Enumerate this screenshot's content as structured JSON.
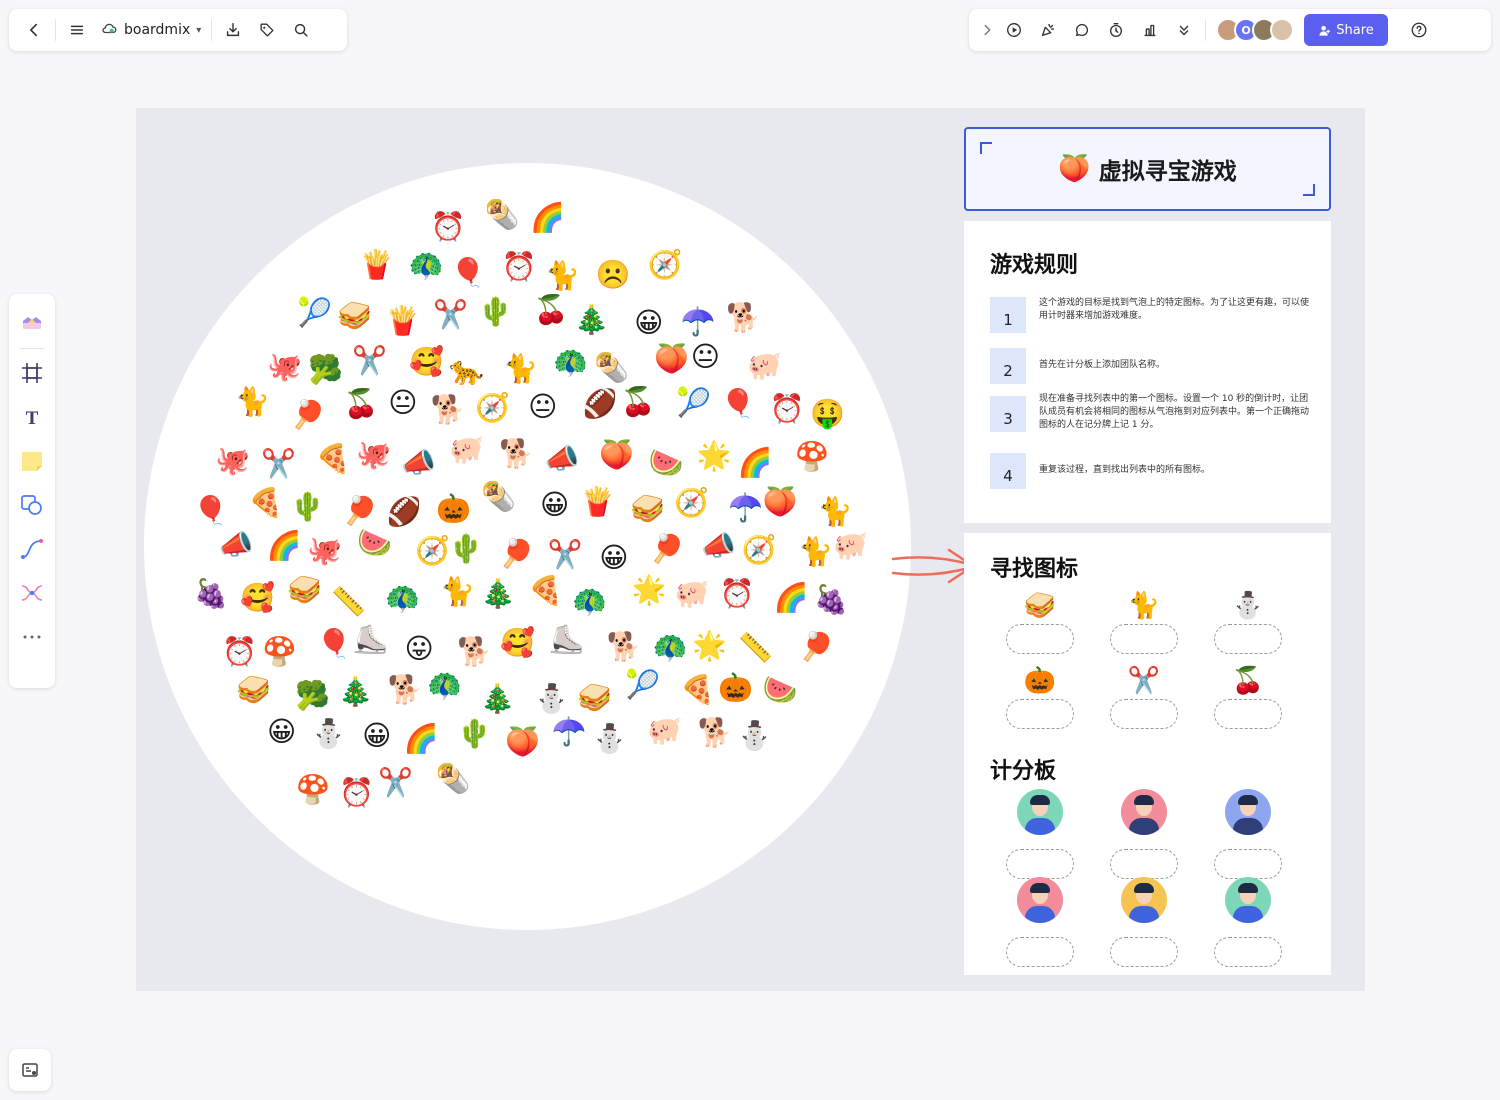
{
  "topbar": {
    "brand": "boardmix",
    "share_label": "Share",
    "avatar_initial": "O"
  },
  "board": {
    "title": "虚拟寻宝游戏",
    "title_emoji": "🍑",
    "rules_heading": "游戏规则",
    "rules": [
      {
        "num": "1",
        "text": "这个游戏的目标是找到气泡上的特定图标。为了让这更有趣，可以使用计时器来增加游戏难度。"
      },
      {
        "num": "2",
        "text": "首先在计分板上添加团队名称。"
      },
      {
        "num": "3",
        "text": "现在准备寻找列表中的第一个图标。设置一个 10 秒的倒计时，让团队成员有机会将相同的图标从气泡拖到对应列表中。第一个正确拖动图标的人在记分牌上记 1 分。"
      },
      {
        "num": "4",
        "text": "重复该过程，直到找出列表中的所有图标。"
      }
    ],
    "find_heading": "寻找图标",
    "targets": [
      "🥪",
      "🐈",
      "⛄",
      "🎃",
      "✂️",
      "🍒"
    ],
    "score_heading": "计分板",
    "players": [
      {
        "bg": "#7ed6b8",
        "body": "#3e63dd",
        "hair": "#1f2a44"
      },
      {
        "bg": "#f28b9a",
        "body": "#2e3f7a",
        "hair": "#1f2a44"
      },
      {
        "bg": "#8ea6f0",
        "body": "#2e3f7a",
        "hair": "#1f2a44"
      },
      {
        "bg": "#f28b9a",
        "body": "#3e63dd",
        "hair": "#1f2a44"
      },
      {
        "bg": "#f5c453",
        "body": "#3e63dd",
        "hair": "#1f2a44"
      },
      {
        "bg": "#7ed6b8",
        "body": "#3e63dd",
        "hair": "#1f2a44"
      }
    ]
  },
  "bubble_emojis": [
    "⏰",
    "🌯",
    "🌈",
    "🍟",
    "🦚",
    "🎈",
    "⏰",
    "🐈",
    "☹️",
    "🧭",
    "🎾",
    "🥪",
    "🍟",
    "✂️",
    "🌵",
    "🍒",
    "🎄",
    "😀",
    "☂️",
    "🐕",
    "🐙",
    "🥦",
    "✂️",
    "🥰",
    "🐆",
    "🐈",
    "🦚",
    "🌯",
    "🍑",
    "😐",
    "🐖",
    "🐈",
    "🏓",
    "🍒",
    "😐",
    "🐕",
    "🧭",
    "😐",
    "🏈",
    "🍒",
    "🎾",
    "🎈",
    "⏰",
    "🤑",
    "🐙",
    "✂️",
    "🍕",
    "🐙",
    "📣",
    "🐖",
    "🐕",
    "📣",
    "🍑",
    "🍉",
    "🌟",
    "🌈",
    "🍄",
    "🎈",
    "🍕",
    "🌵",
    "🏓",
    "🏈",
    "🎃",
    "🌯",
    "😀",
    "🍟",
    "🥪",
    "🧭",
    "☂️",
    "🍑",
    "🐈",
    "📣",
    "🌈",
    "🐙",
    "🍉",
    "🧭",
    "🌵",
    "🏓",
    "✂️",
    "😀",
    "🏓",
    "📣",
    "🧭",
    "🐈",
    "🐖",
    "🍇",
    "🥰",
    "🥪",
    "📏",
    "🦚",
    "🐈",
    "🎄",
    "🍕",
    "🦚",
    "🌟",
    "🐖",
    "⏰",
    "🌈",
    "🍇",
    "⏰",
    "🍄",
    "🎈",
    "⛸️",
    "😛",
    "🐕",
    "🥰",
    "⛸️",
    "🐕",
    "🦚",
    "🌟",
    "📏",
    "🏓",
    "🥪",
    "🥦",
    "🎄",
    "🐕",
    "🦚",
    "🎄",
    "⛄",
    "🥪",
    "🎾",
    "🍕",
    "🎃",
    "🍉",
    "😀",
    "⛄",
    "😀",
    "🌈",
    "🌵",
    "🍑",
    "☂️",
    "⛄",
    "🐖",
    "🐕",
    "⛄",
    "🍄",
    "⏰",
    "✂️",
    "🌯"
  ]
}
